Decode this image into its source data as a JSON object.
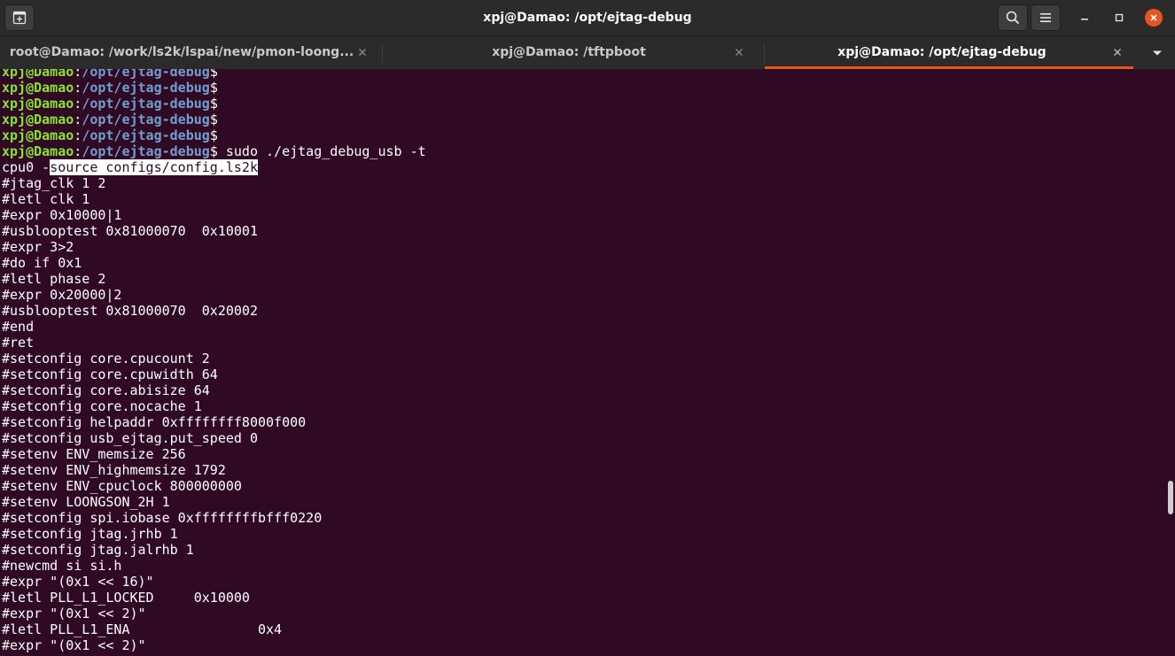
{
  "window": {
    "title": "xpj@Damao: /opt/ejtag-debug"
  },
  "tabs": [
    {
      "label": "root@Damao: /work/ls2k/lspai/new/pmon-loong...",
      "active": false
    },
    {
      "label": "xpj@Damao: /tftpboot",
      "active": false
    },
    {
      "label": "xpj@Damao: /opt/ejtag-debug",
      "active": true
    }
  ],
  "colors": {
    "accent": "#e95420",
    "terminal_bg": "#300a24",
    "prompt_user": "#8ae234",
    "prompt_path": "#729fcf"
  },
  "icons": {
    "new_tab": "new-tab-icon",
    "search": "search-icon",
    "menu": "hamburger-menu-icon",
    "minimize": "minimize-icon",
    "maximize": "maximize-icon",
    "close": "close-icon",
    "tab_close": "close-icon",
    "tabs_dropdown": "chevron-down-icon"
  },
  "terminal": {
    "prompt": {
      "user": "xpj@Damao",
      "colon": ":",
      "path": "/opt/ejtag-debug",
      "symbol": "$"
    },
    "empty_prompt_count": 5,
    "command": " sudo ./ejtag_debug_usb -t",
    "source_line": {
      "prefix": "cpu0 -",
      "highlighted": "source configs/config.ls2k"
    },
    "output": [
      "#jtag_clk 1 2",
      "#letl clk 1",
      "#expr 0x10000|1",
      "#usblooptest 0x81000070  0x10001",
      "#expr 3>2",
      "#do if 0x1",
      "#letl phase 2",
      "#expr 0x20000|2",
      "#usblooptest 0x81000070  0x20002",
      "#end",
      "#ret",
      "#setconfig core.cpucount 2",
      "#setconfig core.cpuwidth 64",
      "#setconfig core.abisize 64",
      "#setconfig core.nocache 1",
      "#setconfig helpaddr 0xffffffff8000f000",
      "#setconfig usb_ejtag.put_speed 0",
      "#setenv ENV_memsize 256",
      "#setenv ENV_highmemsize 1792",
      "#setenv ENV_cpuclock 800000000",
      "#setenv LOONGSON_2H 1",
      "#setconfig spi.iobase 0xffffffffbfff0220",
      "#setconfig jtag.jrhb 1",
      "#setconfig jtag.jalrhb 1",
      "#newcmd si si.h",
      "#expr \"(0x1 << 16)\"",
      "#letl PLL_L1_LOCKED     0x10000",
      "#expr \"(0x1 << 2)\"",
      "#letl PLL_L1_ENA                0x4",
      "#expr \"(0x1 << 2)\""
    ]
  }
}
